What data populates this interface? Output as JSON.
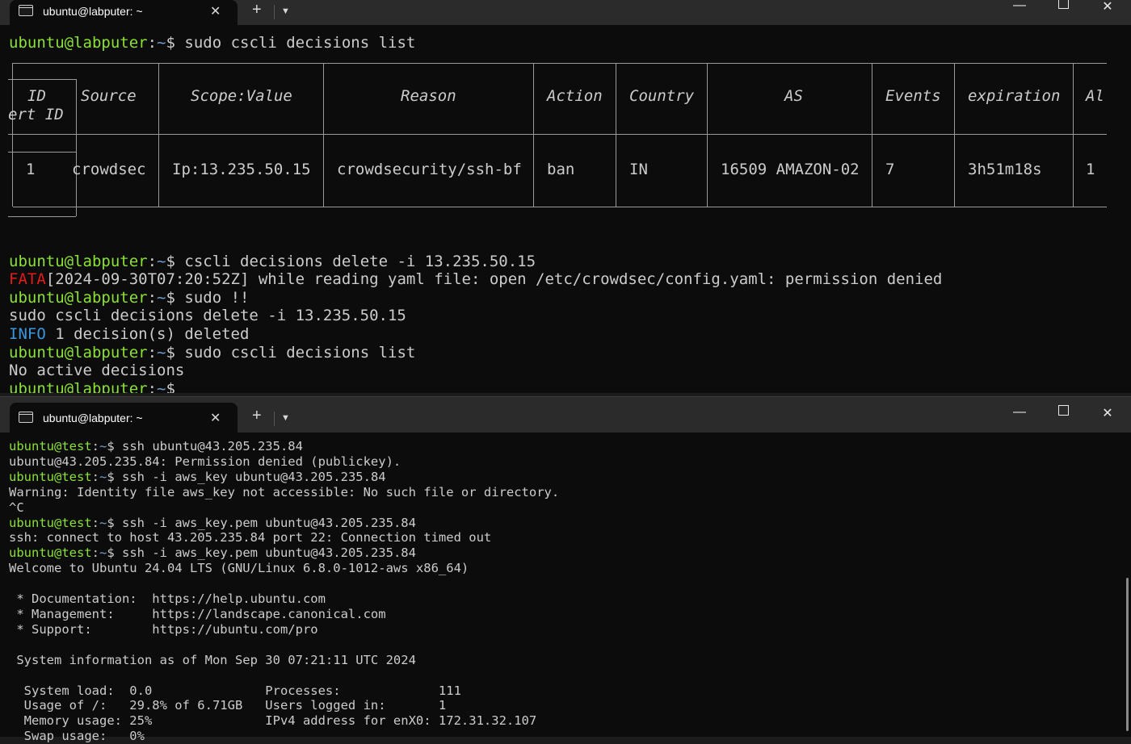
{
  "windows": [
    {
      "tab_title": "ubuntu@labputer: ~",
      "lines": [
        {
          "user": "ubuntu@labputer",
          "path": "~",
          "cmd": "$ sudo cscli decisions list"
        }
      ],
      "table": {
        "headers": [
          "ID",
          "Source",
          "Scope:Value",
          "Reason",
          "Action",
          "Country",
          "AS",
          "Events",
          "expiration",
          "Al"
        ],
        "header_wrap": "ert ID",
        "row": [
          "1",
          "crowdsec",
          "Ip:13.235.50.15",
          "crowdsecurity/ssh-bf",
          "ban",
          "IN",
          "16509 AMAZON-02",
          "7",
          "3h51m18s",
          "1"
        ]
      },
      "after": [
        {
          "user": "ubuntu@labputer",
          "path": "~",
          "cmd": "$ cscli decisions delete -i 13.235.50.15"
        },
        {
          "level": "FATA",
          "text": "[2024-09-30T07:20:52Z] while reading yaml file: open /etc/crowdsec/config.yaml: permission denied"
        },
        {
          "user": "ubuntu@labputer",
          "path": "~",
          "cmd": "$ sudo !!"
        },
        {
          "text": "sudo cscli decisions delete -i 13.235.50.15"
        },
        {
          "level": "INFO",
          "text": " 1 decision(s) deleted"
        },
        {
          "user": "ubuntu@labputer",
          "path": "~",
          "cmd": "$ sudo cscli decisions list"
        },
        {
          "text": "No active decisions"
        },
        {
          "user": "ubuntu@labputer",
          "path": "~",
          "cmd": "$"
        }
      ]
    },
    {
      "tab_title": "ubuntu@labputer: ~",
      "lines": [
        {
          "user": "ubuntu@test",
          "path": "~",
          "cmd": "$ ssh ubuntu@43.205.235.84"
        },
        {
          "text": "ubuntu@43.205.235.84: Permission denied (publickey)."
        },
        {
          "user": "ubuntu@test",
          "path": "~",
          "cmd": "$ ssh -i aws_key ubuntu@43.205.235.84"
        },
        {
          "text": "Warning: Identity file aws_key not accessible: No such file or directory."
        },
        {
          "text": "^C"
        },
        {
          "user": "ubuntu@test",
          "path": "~",
          "cmd": "$ ssh -i aws_key.pem ubuntu@43.205.235.84"
        },
        {
          "text": "ssh: connect to host 43.205.235.84 port 22: Connection timed out"
        },
        {
          "user": "ubuntu@test",
          "path": "~",
          "cmd": "$ ssh -i aws_key.pem ubuntu@43.205.235.84"
        },
        {
          "text": "Welcome to Ubuntu 24.04 LTS (GNU/Linux 6.8.0-1012-aws x86_64)"
        },
        {
          "text": ""
        },
        {
          "text": " * Documentation:  https://help.ubuntu.com"
        },
        {
          "text": " * Management:     https://landscape.canonical.com"
        },
        {
          "text": " * Support:        https://ubuntu.com/pro"
        },
        {
          "text": ""
        },
        {
          "text": " System information as of Mon Sep 30 07:21:11 UTC 2024"
        },
        {
          "text": ""
        },
        {
          "text": "  System load:  0.0               Processes:             111"
        },
        {
          "text": "  Usage of /:   29.8% of 6.71GB   Users logged in:       1"
        },
        {
          "text": "  Memory usage: 25%               IPv4 address for enX0: 172.31.32.107"
        },
        {
          "text": "  Swap usage:   0%"
        }
      ]
    }
  ],
  "icons": {
    "terminal": "terminal-icon",
    "close": "close-icon",
    "plus": "plus-icon",
    "chevron": "chevron-down-icon",
    "minimize": "minimize-icon",
    "maximize": "maximize-icon"
  },
  "glyphs": {
    "close": "✕",
    "plus": "+",
    "chevron": "⌄",
    "minimize": "—"
  },
  "colors": {
    "prompt_user": "#8ae234",
    "prompt_path": "#729fcf",
    "fata": "#e31b1b",
    "info": "#3a96dd",
    "background": "#0c0c0c",
    "text": "#cccccc"
  }
}
